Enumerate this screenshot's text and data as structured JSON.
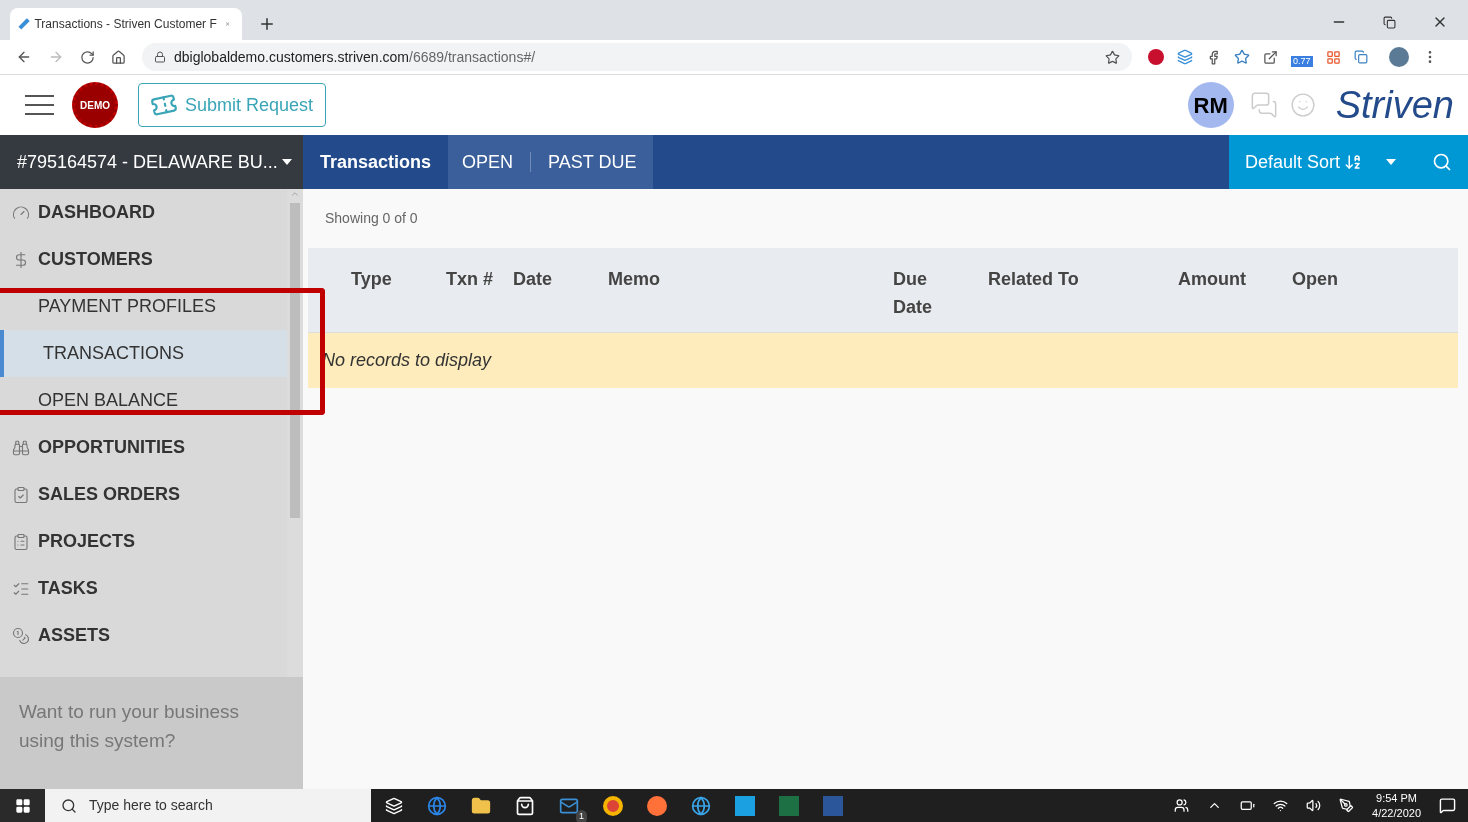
{
  "browser": {
    "tab_title": "Transactions - Striven Customer F",
    "url_host": "dbiglobaldemo.customers.striven.com",
    "url_path": "/6689/transactions#/",
    "extension_badge": "0.77"
  },
  "header": {
    "demo_badge": "DEMO",
    "submit_button": "Submit Request",
    "avatar": "RM",
    "logo": "Striven"
  },
  "account_selector": "#795164574 - DELAWARE BU...",
  "nav_tabs": [
    {
      "label": "Transactions",
      "selected": true
    },
    {
      "label": "OPEN",
      "selected": false
    },
    {
      "label": "PAST DUE",
      "selected": false
    }
  ],
  "sort": {
    "label": "Default Sort"
  },
  "sidebar": {
    "items": [
      {
        "kind": "section",
        "label": "DASHBOARD",
        "selected": false
      },
      {
        "kind": "section",
        "label": "CUSTOMERS",
        "selected": false
      },
      {
        "kind": "sub",
        "label": "PAYMENT PROFILES",
        "selected": false
      },
      {
        "kind": "sub",
        "label": "TRANSACTIONS",
        "selected": true
      },
      {
        "kind": "sub",
        "label": "OPEN BALANCE",
        "selected": false
      },
      {
        "kind": "section",
        "label": "OPPORTUNITIES",
        "selected": false
      },
      {
        "kind": "section",
        "label": "SALES ORDERS",
        "selected": false
      },
      {
        "kind": "section",
        "label": "PROJECTS",
        "selected": false
      },
      {
        "kind": "section",
        "label": "TASKS",
        "selected": false
      },
      {
        "kind": "section",
        "label": "ASSETS",
        "selected": false
      }
    ],
    "promo": "Want to run your business using this system?"
  },
  "content": {
    "showing": "Showing 0 of 0",
    "table": {
      "columns": [
        "Type",
        "Txn #",
        "Date",
        "Memo",
        "Due Date",
        "Related To",
        "Amount",
        "Open"
      ],
      "empty_message": "No records to display"
    }
  },
  "taskbar": {
    "search_placeholder": "Type here to search",
    "mail_badge": "1",
    "time": "9:54 PM",
    "date": "4/22/2020"
  }
}
